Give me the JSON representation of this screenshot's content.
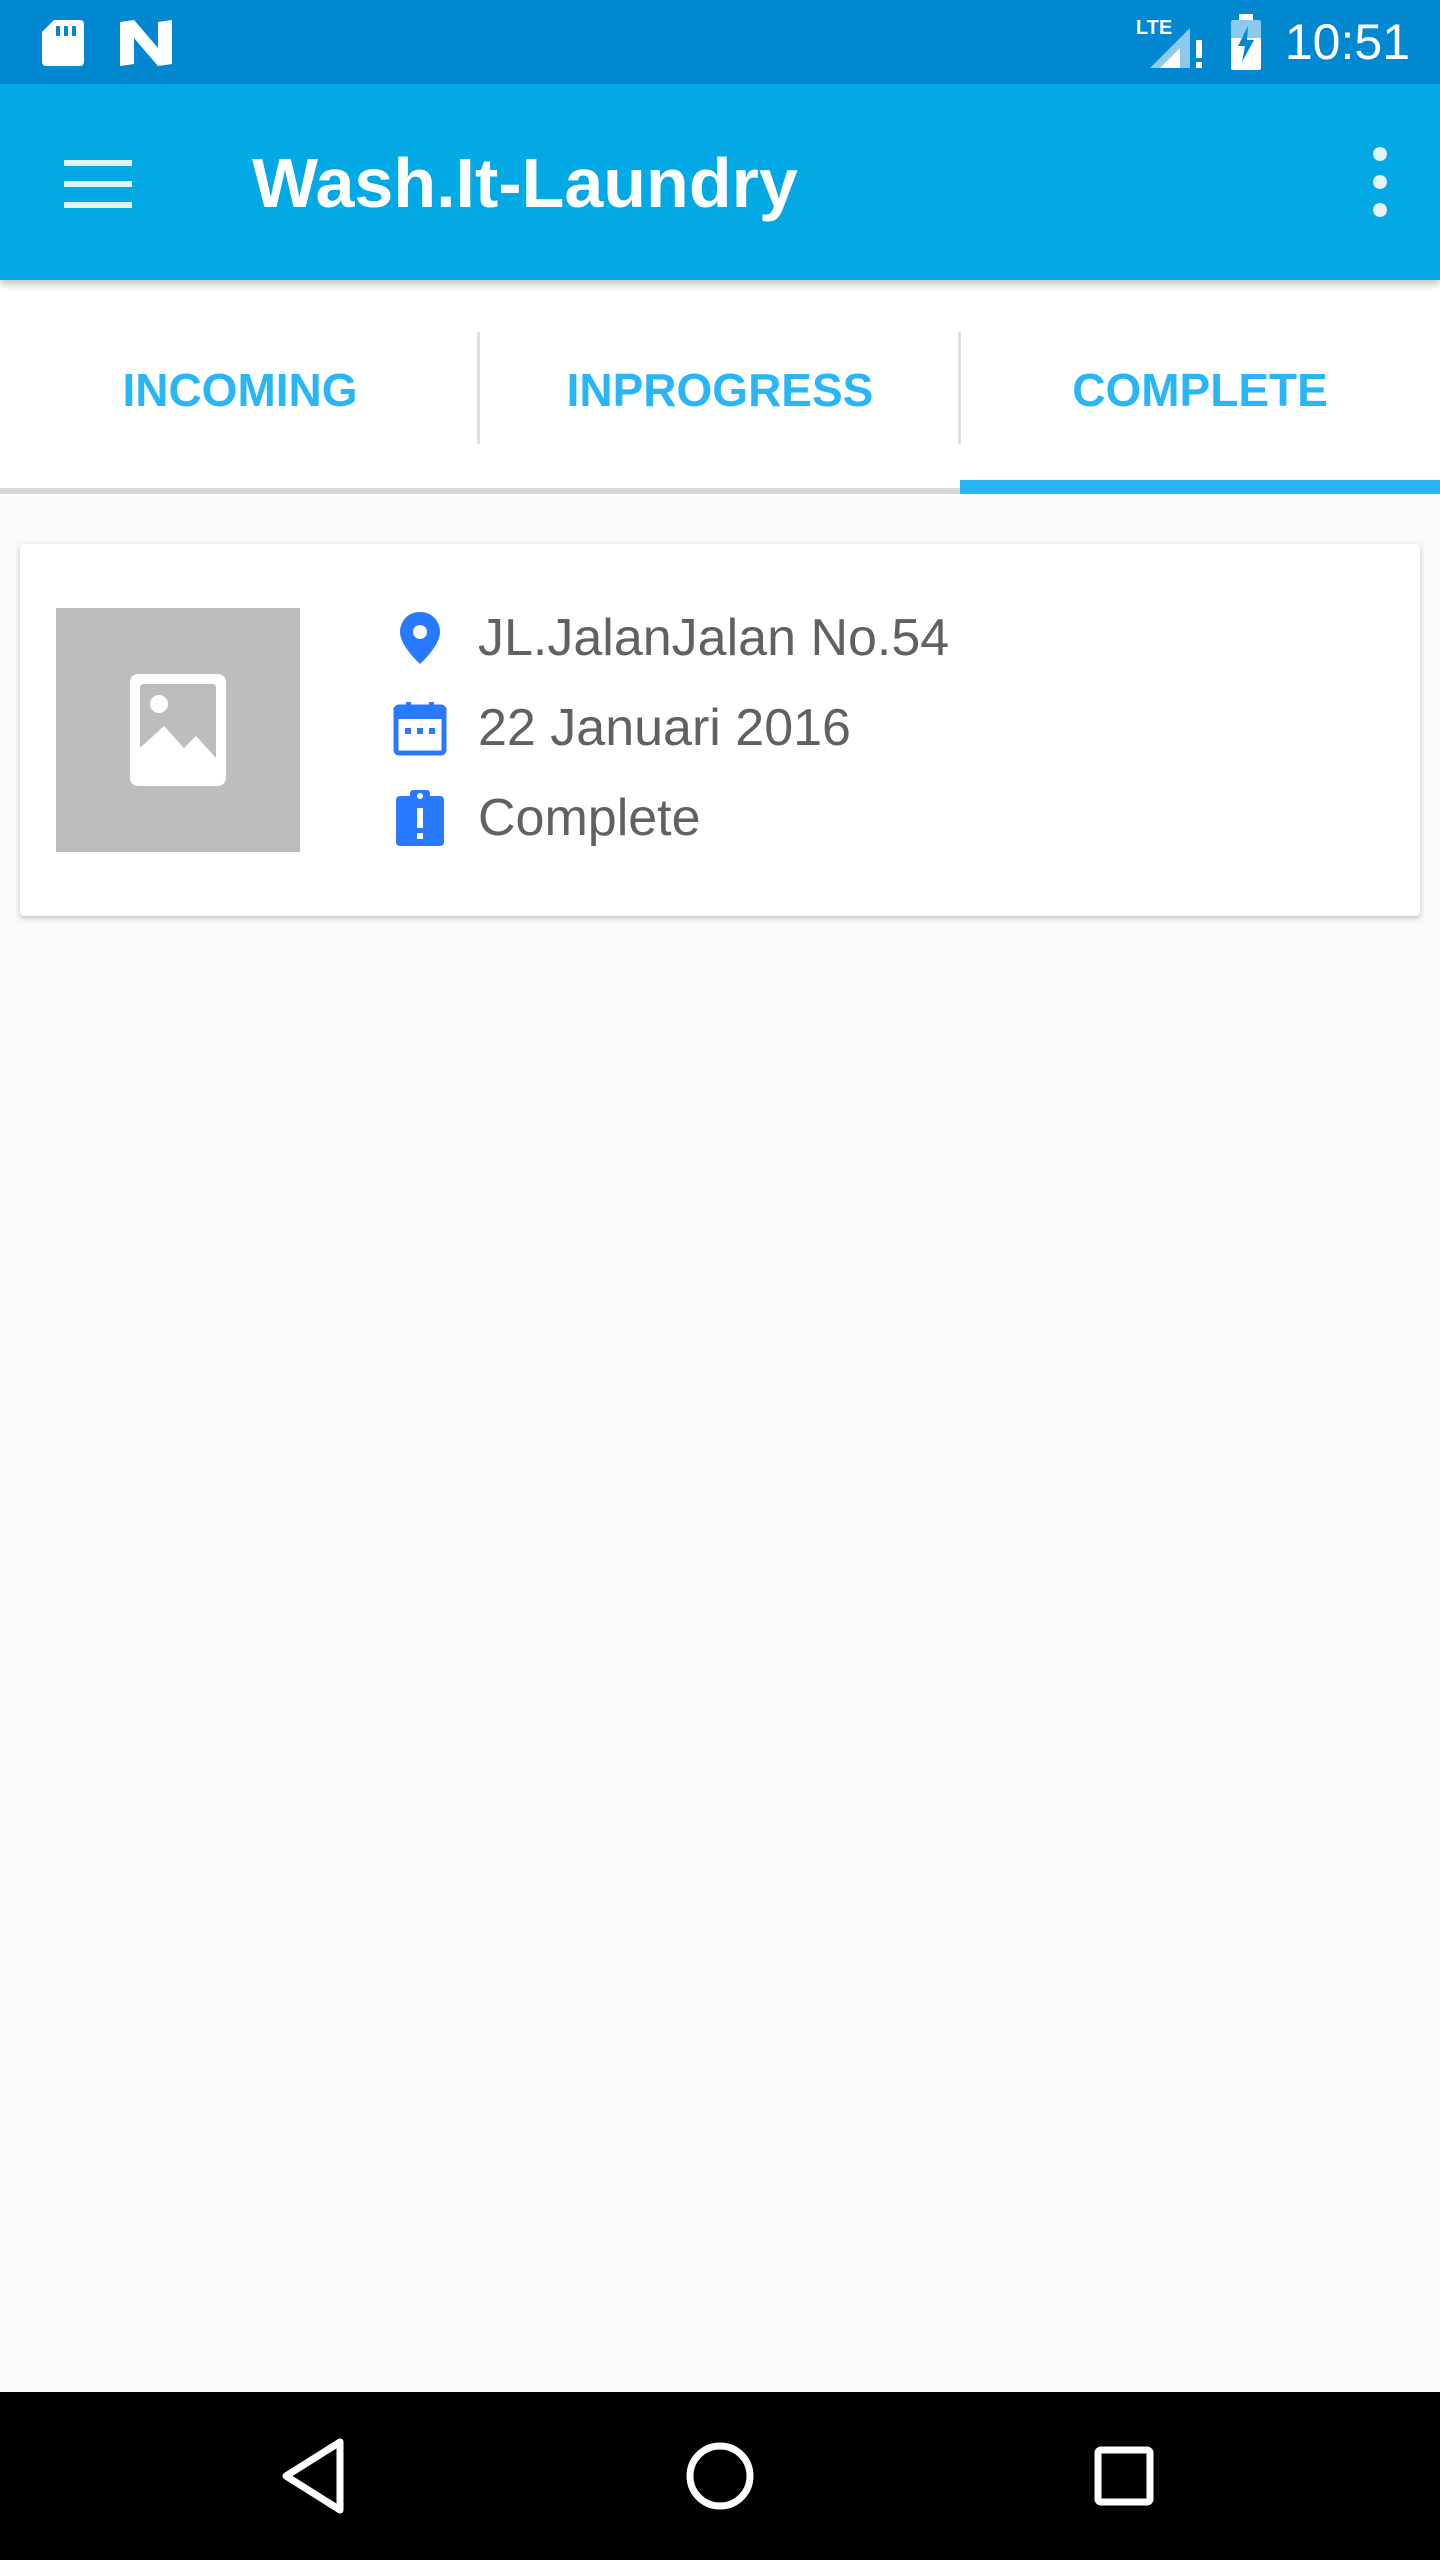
{
  "status_bar": {
    "time": "10:51",
    "icons": [
      "sd-card-icon",
      "n-notification-icon",
      "lte-signal-icon",
      "battery-charging-icon"
    ],
    "network_label": "LTE"
  },
  "app_bar": {
    "title": "Wash.It-Laundry",
    "menu_icon": "hamburger-menu-icon",
    "overflow_icon": "more-vertical-icon",
    "color": "#03A9E4"
  },
  "tabs": [
    {
      "label": "INCOMING",
      "selected": false
    },
    {
      "label": "INPROGRESS",
      "selected": false
    },
    {
      "label": "COMPLETE",
      "selected": true
    }
  ],
  "accent_color": "#29B6F6",
  "orders": [
    {
      "thumbnail_icon": "image-placeholder-icon",
      "address": "JL.JalanJalan No.54",
      "date": "22 Januari 2016",
      "status": "Complete",
      "icons": [
        "location-pin-icon",
        "calendar-icon",
        "clipboard-alert-icon"
      ]
    }
  ],
  "icon_color": "#2979FF",
  "nav_bar": {
    "icons": [
      "back-icon",
      "home-icon",
      "recents-icon"
    ]
  }
}
